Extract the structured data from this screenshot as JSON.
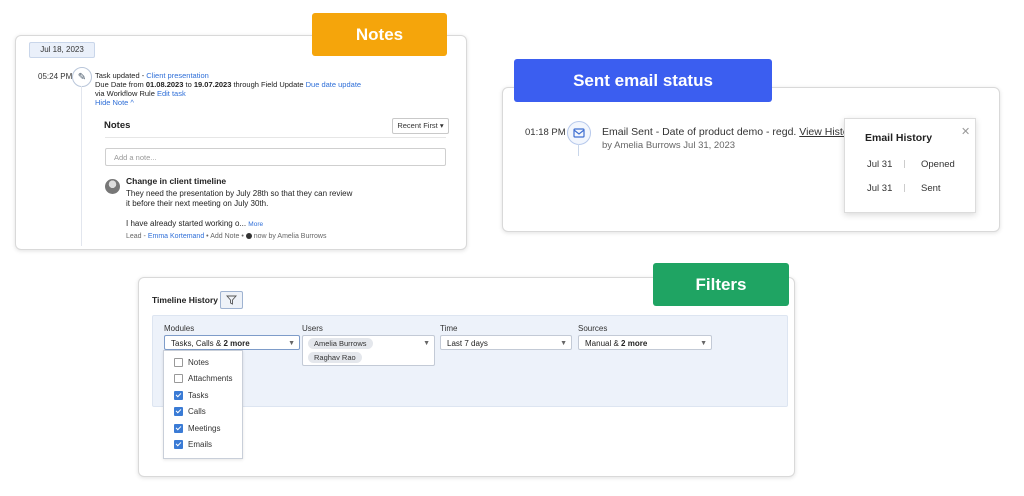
{
  "colors": {
    "notes_tag": "#f5a50b",
    "sent_tag": "#3b5ef0",
    "filters_tag": "#1fa463",
    "link": "#2f6fd8"
  },
  "notes": {
    "tag": "Notes",
    "date": "Jul 18, 2023",
    "time": "05:24 PM",
    "task_prefix": "Task updated - ",
    "task_link": "Client presentation",
    "due_prefix": "Due Date from ",
    "due_from": "01.08.2023",
    "due_mid": " to ",
    "due_to": "19.07.2023",
    "due_suffix": " through Field Update ",
    "due_link": "Due date update",
    "via_prefix": "via Workflow Rule ",
    "via_link": "Edit task",
    "hide_note": "Hide Note ^",
    "title": "Notes",
    "sort": "Recent First",
    "input_placeholder": "Add a note...",
    "note_title": "Change in client timeline",
    "note_line1": "They need the presentation by July 28th so that they can review",
    "note_line2": "it before their next meeting on July 30th.",
    "note_line3": "I have already started working o...",
    "more": "More",
    "footer_lead": "Lead",
    "footer_person": "Emma Kortemand",
    "footer_add": "Add Note",
    "footer_time": "now",
    "footer_by": "by Amelia Burrows"
  },
  "email": {
    "tag": "Sent email status",
    "time": "01:18 PM",
    "text": "Email Sent - Date of product demo - regd.",
    "view_history": "View History",
    "sub": "by Amelia Burrows Jul 31, 2023",
    "popup_title": "Email History",
    "history": [
      {
        "date": "Jul 31",
        "status": "Opened"
      },
      {
        "date": "Jul 31",
        "status": "Sent"
      }
    ]
  },
  "filters": {
    "tag": "Filters",
    "title": "Timeline History",
    "modules_label": "Modules",
    "modules_value": "Tasks, Calls & ",
    "modules_more": "2 more",
    "users_label": "Users",
    "users": [
      "Amelia Burrows",
      "Raghav Rao"
    ],
    "time_label": "Time",
    "time_value": "Last 7 days",
    "sources_label": "Sources",
    "sources_value": "Manual & ",
    "sources_more": "2 more",
    "options": [
      {
        "label": "Notes",
        "checked": false
      },
      {
        "label": "Attachments",
        "checked": false
      },
      {
        "label": "Tasks",
        "checked": true
      },
      {
        "label": "Calls",
        "checked": true
      },
      {
        "label": "Meetings",
        "checked": true
      },
      {
        "label": "Emails",
        "checked": true
      }
    ]
  }
}
